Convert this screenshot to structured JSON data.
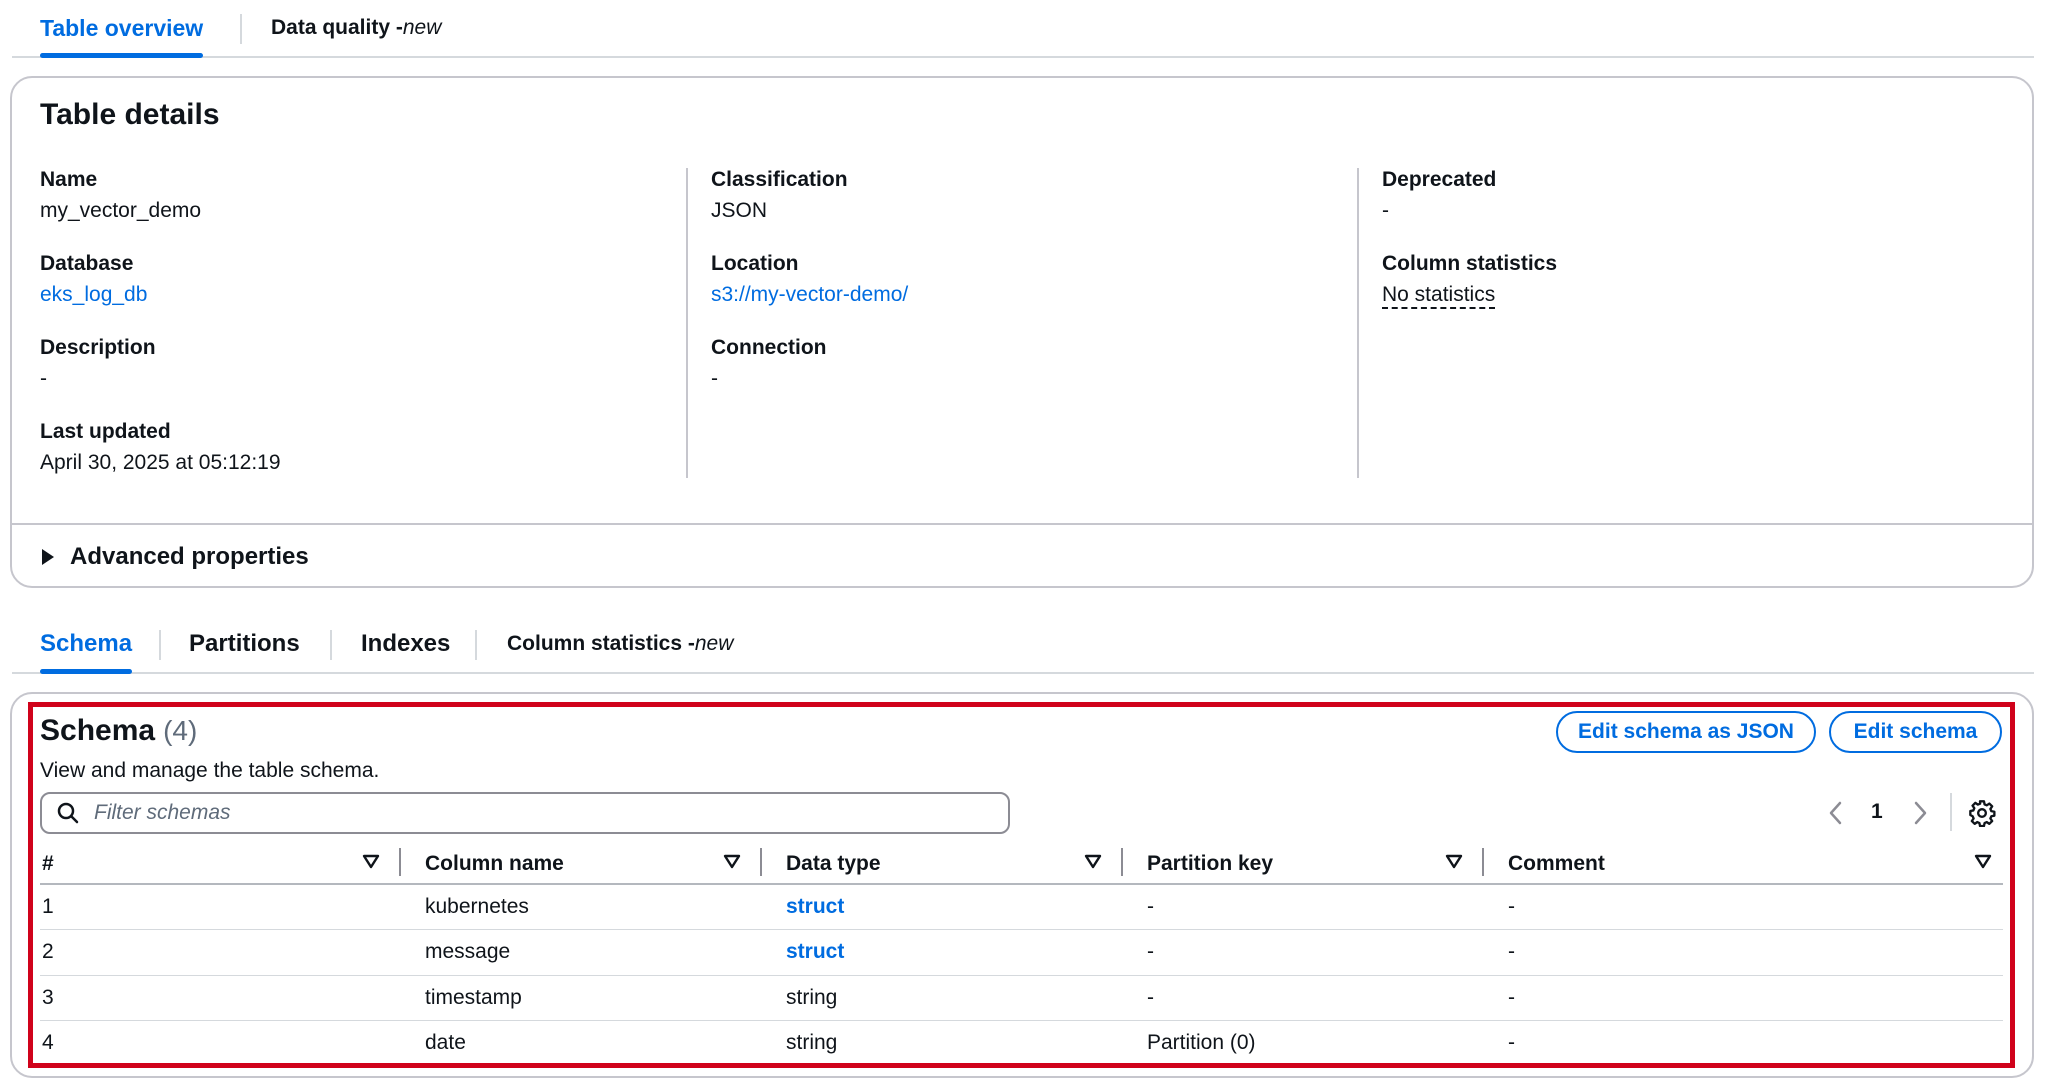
{
  "top_tabs": [
    {
      "label": "Table overview",
      "suffix": ""
    },
    {
      "label": "Data quality - ",
      "suffix": "new"
    }
  ],
  "details": {
    "title": "Table details",
    "name_label": "Name",
    "name_value": "my_vector_demo",
    "database_label": "Database",
    "database_value": "eks_log_db",
    "description_label": "Description",
    "description_value": "-",
    "last_updated_label": "Last updated",
    "last_updated_value": "April 30, 2025 at 05:12:19",
    "classification_label": "Classification",
    "classification_value": "JSON",
    "location_label": "Location",
    "location_value": "s3://my-vector-demo/",
    "connection_label": "Connection",
    "connection_value": "-",
    "deprecated_label": "Deprecated",
    "deprecated_value": "-",
    "column_statistics_label": "Column statistics",
    "column_statistics_value": "No statistics",
    "advanced_properties": "Advanced properties"
  },
  "sub_tabs": [
    {
      "label": "Schema",
      "suffix": ""
    },
    {
      "label": "Partitions",
      "suffix": ""
    },
    {
      "label": "Indexes",
      "suffix": ""
    },
    {
      "label": "Column statistics - ",
      "suffix": "new"
    }
  ],
  "schema": {
    "title": "Schema",
    "count": "(4)",
    "description": "View and manage the table schema.",
    "edit_json_button": "Edit schema as JSON",
    "edit_button": "Edit schema",
    "filter_placeholder": "Filter schemas",
    "page": "1",
    "columns": [
      "#",
      "Column name",
      "Data type",
      "Partition key",
      "Comment"
    ],
    "rows": [
      [
        "1",
        "kubernetes",
        "struct",
        "-",
        "-"
      ],
      [
        "2",
        "message",
        "struct",
        "-",
        "-"
      ],
      [
        "3",
        "timestamp",
        "string",
        "-",
        "-"
      ],
      [
        "4",
        "date",
        "string",
        "Partition (0)",
        "-"
      ]
    ]
  },
  "colors": {
    "accent": "#006ce0",
    "highlight": "#d0021b",
    "text": "#0f141a"
  }
}
